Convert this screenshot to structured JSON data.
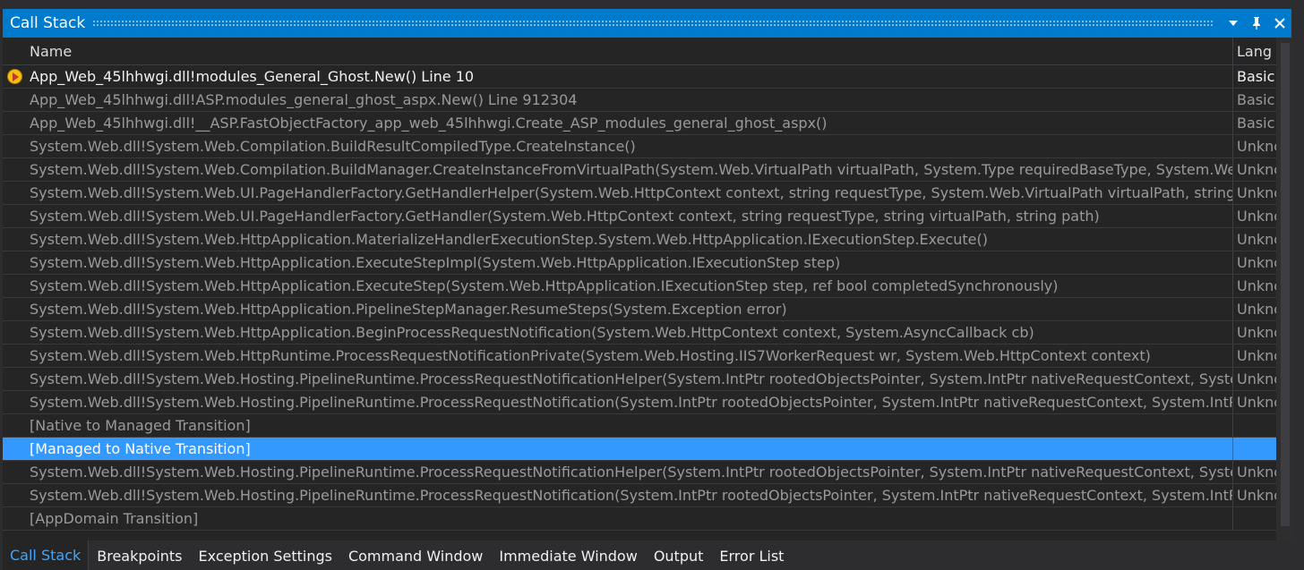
{
  "window": {
    "title": "Call Stack",
    "dropdown_icon": "▾",
    "pin_icon": "📌",
    "close_icon": "✕"
  },
  "columns": {
    "name": "Name",
    "language": "Lang"
  },
  "rows": [
    {
      "name": "App_Web_45lhhwgi.dll!modules_General_Ghost.New() Line 10",
      "lang": "Basic"
    },
    {
      "name": "App_Web_45lhhwgi.dll!ASP.modules_general_ghost_aspx.New() Line 912304",
      "lang": "Basic"
    },
    {
      "name": "App_Web_45lhhwgi.dll!__ASP.FastObjectFactory_app_web_45lhhwgi.Create_ASP_modules_general_ghost_aspx()",
      "lang": "Basic"
    },
    {
      "name": "System.Web.dll!System.Web.Compilation.BuildResultCompiledType.CreateInstance()",
      "lang": "Unknown"
    },
    {
      "name": "System.Web.dll!System.Web.Compilation.BuildManager.CreateInstanceFromVirtualPath(System.Web.VirtualPath virtualPath, System.Type requiredBaseType, System.Web.HttpContext context, bool allowCrossApp)",
      "lang": "Unknown"
    },
    {
      "name": "System.Web.dll!System.Web.UI.PageHandlerFactory.GetHandlerHelper(System.Web.HttpContext context, string requestType, System.Web.VirtualPath virtualPath, string physicalPath)",
      "lang": "Unknown"
    },
    {
      "name": "System.Web.dll!System.Web.UI.PageHandlerFactory.GetHandler(System.Web.HttpContext context, string requestType, string virtualPath, string path)",
      "lang": "Unknown"
    },
    {
      "name": "System.Web.dll!System.Web.HttpApplication.MaterializeHandlerExecutionStep.System.Web.HttpApplication.IExecutionStep.Execute()",
      "lang": "Unknown"
    },
    {
      "name": "System.Web.dll!System.Web.HttpApplication.ExecuteStepImpl(System.Web.HttpApplication.IExecutionStep step)",
      "lang": "Unknown"
    },
    {
      "name": "System.Web.dll!System.Web.HttpApplication.ExecuteStep(System.Web.HttpApplication.IExecutionStep step, ref bool completedSynchronously)",
      "lang": "Unknown"
    },
    {
      "name": "System.Web.dll!System.Web.HttpApplication.PipelineStepManager.ResumeSteps(System.Exception error)",
      "lang": "Unknown"
    },
    {
      "name": "System.Web.dll!System.Web.HttpApplication.BeginProcessRequestNotification(System.Web.HttpContext context, System.AsyncCallback cb)",
      "lang": "Unknown"
    },
    {
      "name": "System.Web.dll!System.Web.HttpRuntime.ProcessRequestNotificationPrivate(System.Web.Hosting.IIS7WorkerRequest wr, System.Web.HttpContext context)",
      "lang": "Unknown"
    },
    {
      "name": "System.Web.dll!System.Web.Hosting.PipelineRuntime.ProcessRequestNotificationHelper(System.IntPtr rootedObjectsPointer, System.IntPtr nativeRequestContext, System.IntPtr moduleData, int flags)",
      "lang": "Unknown"
    },
    {
      "name": "System.Web.dll!System.Web.Hosting.PipelineRuntime.ProcessRequestNotification(System.IntPtr rootedObjectsPointer, System.IntPtr nativeRequestContext, System.IntPtr moduleData, int flags)",
      "lang": "Unknown"
    },
    {
      "name": "[Native to Managed Transition]",
      "lang": ""
    },
    {
      "name": "[Managed to Native Transition]",
      "lang": ""
    },
    {
      "name": "System.Web.dll!System.Web.Hosting.PipelineRuntime.ProcessRequestNotificationHelper(System.IntPtr rootedObjectsPointer, System.IntPtr nativeRequestContext, System.IntPtr moduleData, int flags)",
      "lang": "Unknown"
    },
    {
      "name": "System.Web.dll!System.Web.Hosting.PipelineRuntime.ProcessRequestNotification(System.IntPtr rootedObjectsPointer, System.IntPtr nativeRequestContext, System.IntPtr moduleData, int flags)",
      "lang": "Unknown"
    },
    {
      "name": "[AppDomain Transition]",
      "lang": ""
    }
  ],
  "tabs": [
    {
      "label": "Call Stack",
      "active": true
    },
    {
      "label": "Breakpoints",
      "active": false
    },
    {
      "label": "Exception Settings",
      "active": false
    },
    {
      "label": "Command Window",
      "active": false
    },
    {
      "label": "Immediate Window",
      "active": false
    },
    {
      "label": "Output",
      "active": false
    },
    {
      "label": "Error List",
      "active": false
    }
  ],
  "colors": {
    "accent": "#007acc",
    "selection": "#3399ff",
    "active_tab_text": "#3ea6ff",
    "background": "#252526"
  }
}
